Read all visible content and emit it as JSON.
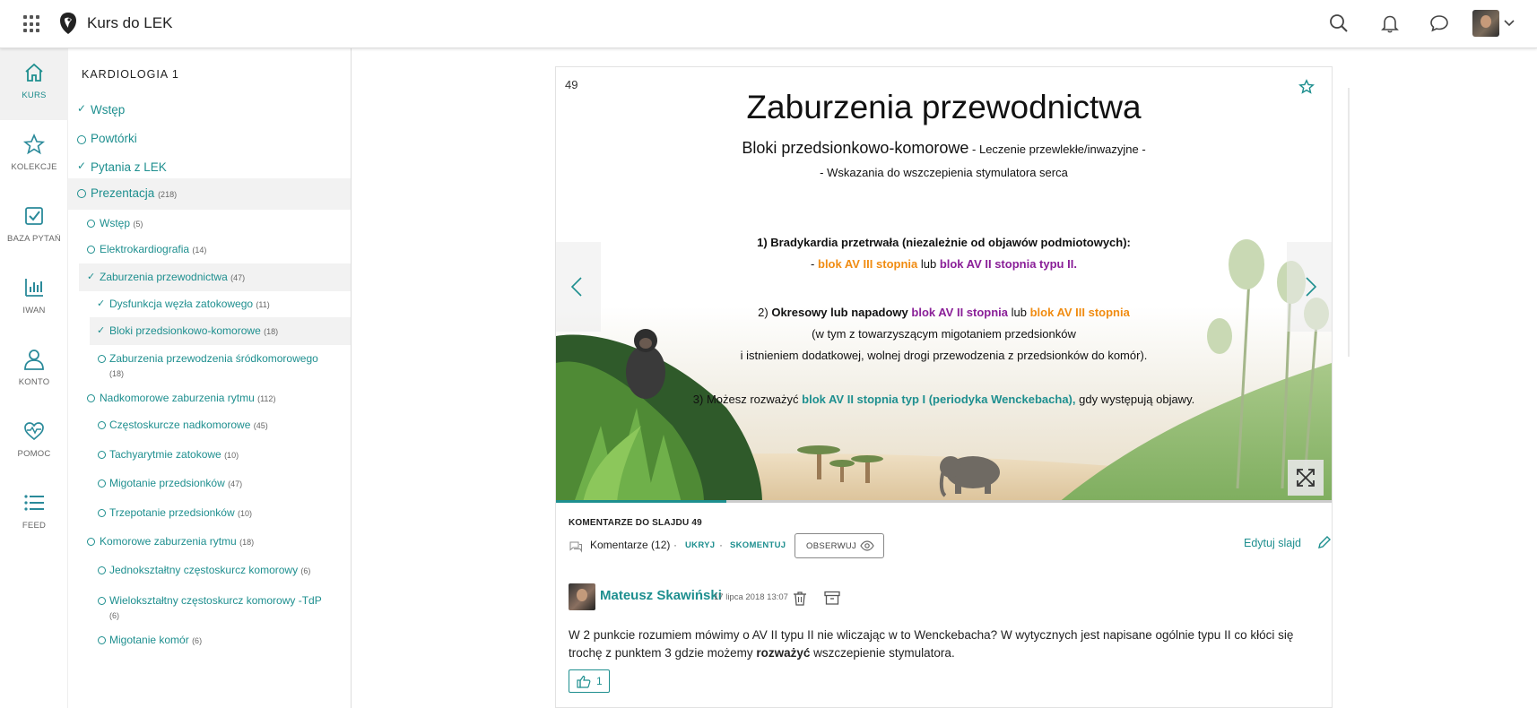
{
  "app": {
    "title": "Kurs do LEK"
  },
  "rail": {
    "items": [
      {
        "label": "KURS",
        "icon": "home-icon"
      },
      {
        "label": "KOLEKCJE",
        "icon": "star-icon"
      },
      {
        "label": "BAZA PYTAŃ",
        "icon": "checkbox-icon"
      },
      {
        "label": "IWAN",
        "icon": "bar-chart-icon"
      },
      {
        "label": "KONTO",
        "icon": "user-icon"
      },
      {
        "label": "POMOC",
        "icon": "heart-pulse-icon"
      },
      {
        "label": "FEED",
        "icon": "list-icon"
      }
    ]
  },
  "toc": {
    "heading": "KARDIOLOGIA 1",
    "items": [
      {
        "label": "Wstęp",
        "count": "",
        "state": "done"
      },
      {
        "label": "Powtórki",
        "count": "",
        "state": "open"
      },
      {
        "label": "Pytania z LEK",
        "count": "",
        "state": "done"
      },
      {
        "label": "Prezentacja",
        "count": "(218)",
        "state": "open"
      },
      {
        "label": "Wstęp",
        "count": "(5)",
        "state": "open"
      },
      {
        "label": "Elektrokardiografia",
        "count": "(14)",
        "state": "open"
      },
      {
        "label": "Zaburzenia przewodnictwa",
        "count": "(47)",
        "state": "done"
      },
      {
        "label": "Dysfunkcja węzła zatokowego",
        "count": "(11)",
        "state": "done"
      },
      {
        "label": "Bloki przedsionkowo-komorowe",
        "count": "(18)",
        "state": "done"
      },
      {
        "label": "Zaburzenia przewodzenia śródkomorowego",
        "count": "(18)",
        "state": "open"
      },
      {
        "label": "Nadkomorowe zaburzenia rytmu",
        "count": "(112)",
        "state": "open"
      },
      {
        "label": "Częstoskurcze nadkomorowe",
        "count": "(45)",
        "state": "open"
      },
      {
        "label": "Tachyarytmie zatokowe",
        "count": "(10)",
        "state": "open"
      },
      {
        "label": "Migotanie przedsionków",
        "count": "(47)",
        "state": "open"
      },
      {
        "label": "Trzepotanie przedsionków",
        "count": "(10)",
        "state": "open"
      },
      {
        "label": "Komorowe zaburzenia rytmu",
        "count": "(18)",
        "state": "open"
      },
      {
        "label": "Jednokształtny częstoskurcz komorowy",
        "count": "(6)",
        "state": "open"
      },
      {
        "label": "Wielokształtny częstoskurcz komorowy -TdP",
        "count": "(6)",
        "state": "open"
      },
      {
        "label": "Migotanie komór",
        "count": "(6)",
        "state": "open"
      }
    ]
  },
  "slide": {
    "number": "49",
    "title": "Zaburzenia przewodnictwa",
    "subtitle_main": "Bloki przedsionkowo-komorowe",
    "subtitle_rest": " - Leczenie przewlekłe/inwazyjne -",
    "subtitle_line2": "- Wskazania do wszczepienia stymulatora serca",
    "p1_title": "1) Bradykardia przetrwała (niezależnie od objawów podmiotowych):",
    "p1_dash": "- ",
    "p1_a": "blok AV III stopnia",
    "p1_lub": " lub ",
    "p1_b": "blok AV II stopnia typu II.",
    "p2_num": "2) ",
    "p2_title": "Okresowy lub napadowy",
    "p2_a": " blok AV II stopnia",
    "p2_lub": " lub ",
    "p2_b": "blok AV III stopnia",
    "p2_line2": "(w tym z towarzyszącym migotaniem przedsionków",
    "p2_line3": "i istnieniem dodatkowej, wolnej drogi przewodzenia z przedsionków do komór).",
    "p3_pre": "3) Możesz rozważyć ",
    "p3_link": "blok AV II stopnia typ I (periodyka Wenckebacha),",
    "p3_post": " gdy występują objawy.",
    "progress": 0.22
  },
  "comments": {
    "heading": "KOMENTARZE DO SLAJDU 49",
    "count_label": "Komentarze (12)",
    "sep": "·",
    "hide": "UKRYJ",
    "comment": "SKOMENTUJ",
    "observe": "OBSERWUJ",
    "edit": "Edytuj slajd",
    "author": "Mateusz Skawiński",
    "date": "17 lipca 2018 13:07",
    "body_pre": "W 2 punkcie rozumiem mówimy o AV II typu II nie wliczając w to Wenckebacha? W wytycznych jest napisane ogólnie typu II co kłóci się trochę z punktem 3 gdzie możemy ",
    "body_bold": "rozważyć",
    "body_post": " wszczepienie stymulatora.",
    "likes": "1"
  },
  "colors": {
    "accent": "#1e8f8f",
    "orange": "#f08c12",
    "purple": "#8a1f98"
  }
}
